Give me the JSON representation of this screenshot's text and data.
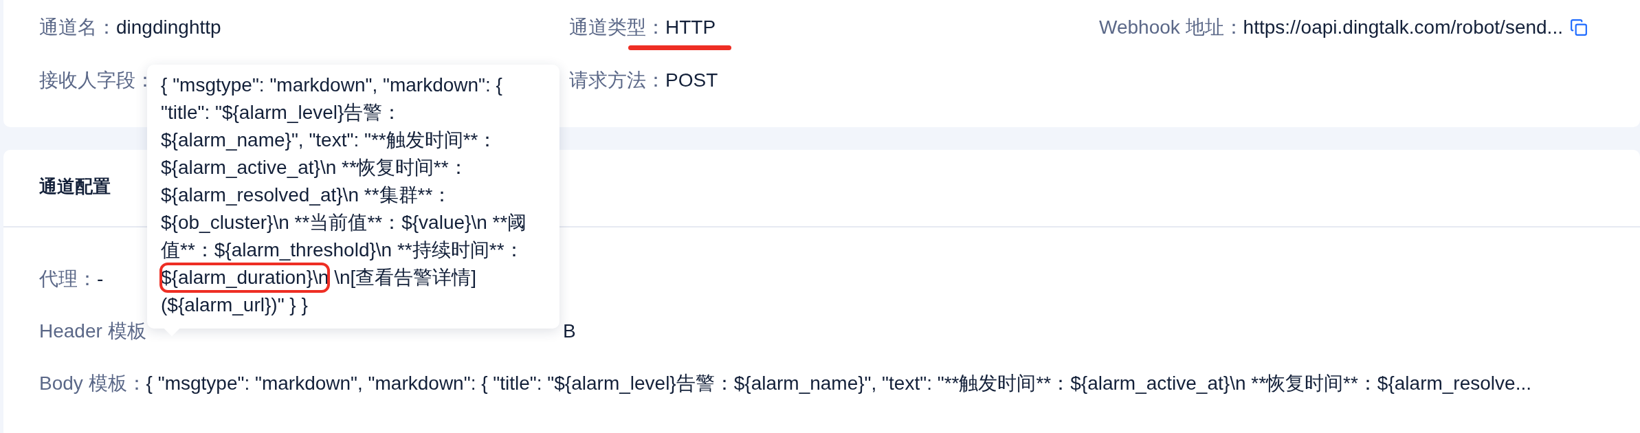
{
  "basic_info": {
    "fields": [
      {
        "label": "通道名：",
        "value": "dingdinghttp"
      },
      {
        "label": "通道类型：",
        "value": "HTTP",
        "underlined": true
      },
      {
        "label": "Webhook 地址：",
        "value": "https://oapi.dingtalk.com/robot/send...",
        "copyable": true
      },
      {
        "label": "接收人字段："
      },
      {
        "label": "请求方法：",
        "value": "POST"
      }
    ]
  },
  "channel_config": {
    "title": "通道配置",
    "fields": [
      {
        "label": "代理：",
        "value": "-"
      },
      {
        "label": "Header 模板",
        "value": "B",
        "partly_hidden": true
      },
      {
        "label": "Body 模板：",
        "value": "{ \"msgtype\": \"markdown\", \"markdown\": { \"title\": \"${alarm_level}告警：${alarm_name}\", \"text\": \"**触发时间**：${alarm_active_at}\\n **恢复时间**：${alarm_resolve..."
      }
    ]
  },
  "tooltip": {
    "lines": [
      [
        {
          "text": "{ \"msgtype\": \"markdown\", \"markdown\": {",
          "circled": false
        }
      ],
      [
        {
          "text": "\"title\": \"${alarm_level}告警：",
          "circled": false
        }
      ],
      [
        {
          "text": "${alarm_name}\", \"text\": \"**触发时间**：",
          "circled": false
        }
      ],
      [
        {
          "text": "${alarm_active_at}\\n **恢复时间**：",
          "circled": false
        }
      ],
      [
        {
          "text": "${alarm_resolved_at}\\n **集群**：",
          "circled": false
        }
      ],
      [
        {
          "text": "${ob_cluster}\\n **当前值**：${value}\\n **阈",
          "circled": false
        }
      ],
      [
        {
          "text": "值**：${alarm_threshold}\\n **持续时间**：",
          "circled": false
        }
      ],
      [
        {
          "text": "${alarm_duration}\\n",
          "circled": true
        },
        {
          "text": " \\n[查看告警详情]",
          "circled": false
        }
      ],
      [
        {
          "text": "(${alarm_url})\" } }",
          "circled": false
        }
      ]
    ]
  }
}
